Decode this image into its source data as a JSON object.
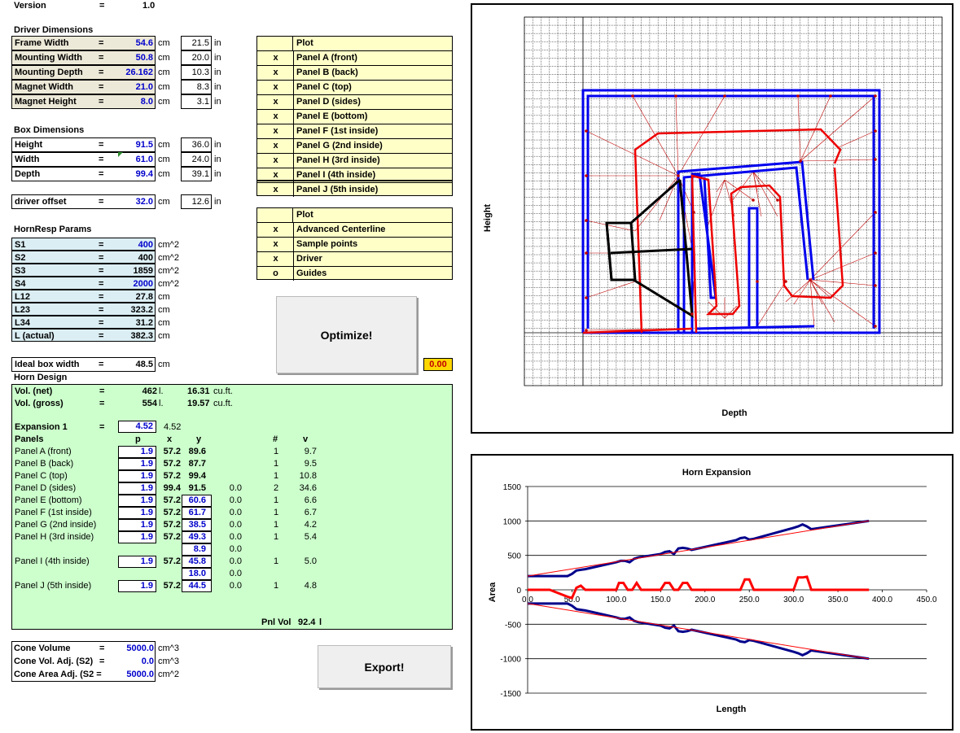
{
  "version": {
    "label": "Version",
    "eq": "=",
    "value": "1.0"
  },
  "driver": {
    "title": "Driver Dimensions",
    "rows": [
      {
        "label": "Frame Width",
        "eq": "=",
        "value": "54.6",
        "unit": "cm",
        "inch": "21.5",
        "inch_unit": "in"
      },
      {
        "label": "Mounting Width",
        "eq": "=",
        "value": "50.8",
        "unit": "cm",
        "inch": "20.0",
        "inch_unit": "in"
      },
      {
        "label": "Mounting Depth",
        "eq": "=",
        "value": "26.162",
        "unit": "cm",
        "inch": "10.3",
        "inch_unit": "in"
      },
      {
        "label": "Magnet Width",
        "eq": "=",
        "value": "21.0",
        "unit": "cm",
        "inch": "8.3",
        "inch_unit": "in"
      },
      {
        "label": "Magnet Height",
        "eq": "=",
        "value": "8.0",
        "unit": "cm",
        "inch": "3.1",
        "inch_unit": "in"
      }
    ]
  },
  "box": {
    "title": "Box Dimensions",
    "rows": [
      {
        "label": "Height",
        "eq": "=",
        "value": "91.5",
        "unit": "cm",
        "inch": "36.0",
        "inch_unit": "in"
      },
      {
        "label": "Width",
        "eq": "=",
        "value": "61.0",
        "unit": "cm",
        "inch": "24.0",
        "inch_unit": "in"
      },
      {
        "label": "Depth",
        "eq": "=",
        "value": "99.4",
        "unit": "cm",
        "inch": "39.1",
        "inch_unit": "in"
      }
    ]
  },
  "offset": {
    "label": "driver offset",
    "eq": "=",
    "value": "32.0",
    "unit": "cm",
    "inch": "12.6",
    "inch_unit": "in"
  },
  "hornresp": {
    "title": "HornResp Params",
    "rows": [
      {
        "label": "S1",
        "eq": "=",
        "value": "400",
        "unit": "cm^2",
        "editable": true
      },
      {
        "label": "S2",
        "eq": "=",
        "value": "400",
        "unit": "cm^2",
        "editable": false
      },
      {
        "label": "S3",
        "eq": "=",
        "value": "1859",
        "unit": "cm^2",
        "editable": false
      },
      {
        "label": "S4",
        "eq": "=",
        "value": "2000",
        "unit": "cm^2",
        "editable": true
      },
      {
        "label": "L12",
        "eq": "=",
        "value": "27.8",
        "unit": "cm",
        "editable": false
      },
      {
        "label": "L23",
        "eq": "=",
        "value": "323.2",
        "unit": "cm",
        "editable": false
      },
      {
        "label": "L34",
        "eq": "=",
        "value": "31.2",
        "unit": "cm",
        "editable": false
      },
      {
        "label": "L (actual)",
        "eq": "=",
        "value": "382.3",
        "unit": "cm",
        "editable": false
      }
    ]
  },
  "ideal": {
    "label": "Ideal box width",
    "eq": "=",
    "value": "48.5",
    "unit": "cm"
  },
  "plot1": {
    "header": "Plot",
    "rows": [
      {
        "mark": "x",
        "label": "Panel A (front)"
      },
      {
        "mark": "x",
        "label": "Panel B (back)"
      },
      {
        "mark": "x",
        "label": "Panel C (top)"
      },
      {
        "mark": "x",
        "label": "Panel D (sides)"
      },
      {
        "mark": "x",
        "label": "Panel E (bottom)"
      },
      {
        "mark": "x",
        "label": "Panel F (1st inside)"
      },
      {
        "mark": "x",
        "label": "Panel G (2nd inside)"
      },
      {
        "mark": "x",
        "label": "Panel H (3rd inside)"
      },
      {
        "mark": "x",
        "label": "Panel I (4th inside)"
      },
      {
        "mark": "x",
        "label": "Panel J (5th inside)"
      }
    ]
  },
  "plot2": {
    "header": "Plot",
    "rows": [
      {
        "mark": "x",
        "label": "Advanced Centerline"
      },
      {
        "mark": "x",
        "label": "Sample points"
      },
      {
        "mark": "x",
        "label": "Driver"
      },
      {
        "mark": "o",
        "label": "Guides"
      }
    ]
  },
  "optimize_label": "Optimize!",
  "export_label": "Export!",
  "error_value": "0.00",
  "horn": {
    "title": "Horn Design",
    "vol_net": {
      "label": "Vol. (net)",
      "eq": "=",
      "value": "462",
      "unit": "l.",
      "cuft": "16.31",
      "cuft_unit": "cu.ft."
    },
    "vol_gross": {
      "label": "Vol. (gross)",
      "eq": "=",
      "value": "554",
      "unit": "l.",
      "cuft": "19.57",
      "cuft_unit": "cu.ft."
    },
    "expansion": {
      "label": "Expansion 1",
      "eq": "=",
      "value": "4.52",
      "calc": "4.52"
    },
    "headers": {
      "panels": "Panels",
      "p": "p",
      "x": "x",
      "y": "y",
      "n": "#",
      "v": "v"
    },
    "panels": [
      {
        "name": "Panel A (front)",
        "p": "1.9",
        "x": "57.2",
        "y": "89.6",
        "z": "",
        "n": "1",
        "v": "9.7",
        "ybox": false
      },
      {
        "name": "Panel B (back)",
        "p": "1.9",
        "x": "57.2",
        "y": "87.7",
        "z": "",
        "n": "1",
        "v": "9.5",
        "ybox": false
      },
      {
        "name": "Panel C (top)",
        "p": "1.9",
        "x": "57.2",
        "y": "99.4",
        "z": "",
        "n": "1",
        "v": "10.8",
        "ybox": false
      },
      {
        "name": "Panel D (sides)",
        "p": "1.9",
        "x": "99.4",
        "y": "91.5",
        "z": "0.0",
        "n": "2",
        "v": "34.6",
        "ybox": false
      },
      {
        "name": "Panel E (bottom)",
        "p": "1.9",
        "x": "57.2",
        "y": "60.6",
        "z": "0.0",
        "n": "1",
        "v": "6.6",
        "ybox": true
      },
      {
        "name": "Panel F (1st inside)",
        "p": "1.9",
        "x": "57.2",
        "y": "61.7",
        "z": "0.0",
        "n": "1",
        "v": "6.7",
        "ybox": true
      },
      {
        "name": "Panel G (2nd inside)",
        "p": "1.9",
        "x": "57.2",
        "y": "38.5",
        "z": "0.0",
        "n": "1",
        "v": "4.2",
        "ybox": true
      },
      {
        "name": "Panel H (3rd inside)",
        "p": "1.9",
        "x": "57.2",
        "y": "49.3",
        "z": "0.0",
        "n": "1",
        "v": "5.4",
        "ybox": true
      }
    ],
    "extra1": {
      "y": "8.9",
      "z": "0.0"
    },
    "panel_i": {
      "name": "Panel I (4th inside)",
      "p": "1.9",
      "x": "57.2",
      "y": "45.8",
      "z": "0.0",
      "n": "1",
      "v": "5.0"
    },
    "extra2": {
      "y": "18.0",
      "z": "0.0"
    },
    "panel_j": {
      "name": "Panel J (5th inside)",
      "p": "1.9",
      "x": "57.2",
      "y": "44.5",
      "z": "0.0",
      "n": "1",
      "v": "4.8"
    },
    "pnl_vol": {
      "label": "Pnl Vol",
      "value": "92.4",
      "unit": "l"
    }
  },
  "cone": [
    {
      "label": "Cone Volume",
      "eq": "=",
      "value": "5000.0",
      "unit": "cm^3"
    },
    {
      "label": "Cone Vol. Adj. (S2)",
      "eq": "=",
      "value": "0.0",
      "unit": "cm^3"
    },
    {
      "label": "Cone Area Adj. (S2 =",
      "eq": "",
      "value": "5000.0",
      "unit": "cm^2"
    }
  ],
  "layout_chart": {
    "xlabel": "Depth",
    "ylabel": "Height"
  },
  "chart_data": {
    "type": "line",
    "title": "Horn Expansion",
    "xlabel": "Length",
    "ylabel": "Area",
    "xlim": [
      0,
      450
    ],
    "ylim": [
      -1500,
      1500
    ],
    "x_ticks": [
      "0.0",
      "50.0",
      "100.0",
      "150.0",
      "200.0",
      "250.0",
      "300.0",
      "350.0",
      "400.0",
      "450.0"
    ],
    "y_ticks": [
      "1500",
      "1000",
      "500",
      "0",
      "-500",
      "-1000",
      "-1500"
    ],
    "grid": "horizontal",
    "series": [
      {
        "color": "#00008b",
        "x": [
          0,
          30,
          45,
          50,
          55,
          60,
          65,
          100,
          105,
          110,
          115,
          120,
          125,
          150,
          155,
          160,
          165,
          170,
          175,
          180,
          185,
          235,
          240,
          245,
          250,
          255,
          300,
          305,
          310,
          315,
          320,
          385
        ],
        "y": [
          200,
          200,
          200,
          230,
          280,
          290,
          300,
          400,
          420,
          420,
          400,
          450,
          470,
          520,
          550,
          560,
          520,
          600,
          610,
          600,
          580,
          720,
          750,
          760,
          730,
          740,
          900,
          920,
          950,
          920,
          880,
          1000
        ]
      },
      {
        "color": "#00008b",
        "x": [
          0,
          30,
          45,
          50,
          55,
          60,
          65,
          100,
          105,
          110,
          115,
          120,
          125,
          150,
          155,
          160,
          165,
          170,
          175,
          180,
          185,
          235,
          240,
          245,
          250,
          255,
          300,
          305,
          310,
          315,
          320,
          385
        ],
        "y": [
          -200,
          -200,
          -200,
          -230,
          -280,
          -290,
          -300,
          -400,
          -420,
          -420,
          -400,
          -450,
          -470,
          -520,
          -550,
          -560,
          -520,
          -600,
          -610,
          -600,
          -580,
          -720,
          -750,
          -760,
          -730,
          -740,
          -900,
          -920,
          -950,
          -920,
          -880,
          -1000
        ]
      },
      {
        "color": "#ff0000",
        "x": [
          0,
          385
        ],
        "y": [
          200,
          1000
        ]
      },
      {
        "color": "#ff0000",
        "x": [
          0,
          385
        ],
        "y": [
          -200,
          -1000
        ]
      },
      {
        "color": "#ff0000",
        "x": [
          0,
          25,
          45,
          50,
          55,
          60,
          65,
          70,
          100,
          103,
          108,
          113,
          118,
          123,
          128,
          150,
          155,
          160,
          165,
          170,
          175,
          180,
          185,
          240,
          245,
          250,
          255,
          300,
          305,
          310,
          315,
          320,
          385
        ],
        "y": [
          0,
          0,
          -100,
          -120,
          30,
          60,
          0,
          0,
          0,
          100,
          100,
          0,
          0,
          100,
          0,
          0,
          100,
          100,
          0,
          0,
          100,
          100,
          0,
          0,
          150,
          150,
          0,
          0,
          180,
          180,
          190,
          0,
          0
        ]
      }
    ]
  }
}
